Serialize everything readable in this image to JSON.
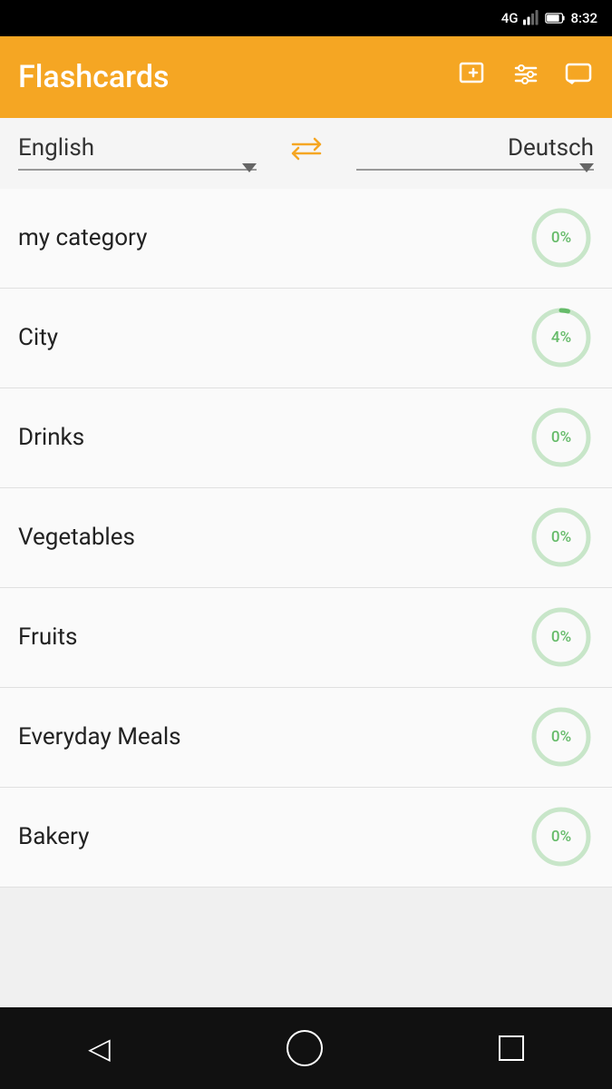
{
  "statusBar": {
    "signal": "4G",
    "time": "8:32"
  },
  "appBar": {
    "title": "Flashcards",
    "icons": [
      "add-card-icon",
      "filter-icon",
      "message-icon"
    ]
  },
  "langSelector": {
    "from": "English",
    "to": "Deutsch",
    "swapSymbol": "⇄"
  },
  "categories": [
    {
      "name": "my category",
      "progress": 0,
      "progressLabel": "0%"
    },
    {
      "name": "City",
      "progress": 4,
      "progressLabel": "4%"
    },
    {
      "name": "Drinks",
      "progress": 0,
      "progressLabel": "0%"
    },
    {
      "name": "Vegetables",
      "progress": 0,
      "progressLabel": "0%"
    },
    {
      "name": "Fruits",
      "progress": 0,
      "progressLabel": "0%"
    },
    {
      "name": "Everyday Meals",
      "progress": 0,
      "progressLabel": "0%"
    },
    {
      "name": "Bakery",
      "progress": 0,
      "progressLabel": "0%"
    }
  ],
  "bottomNav": {
    "back": "◁",
    "home": "○",
    "recent": "□"
  }
}
